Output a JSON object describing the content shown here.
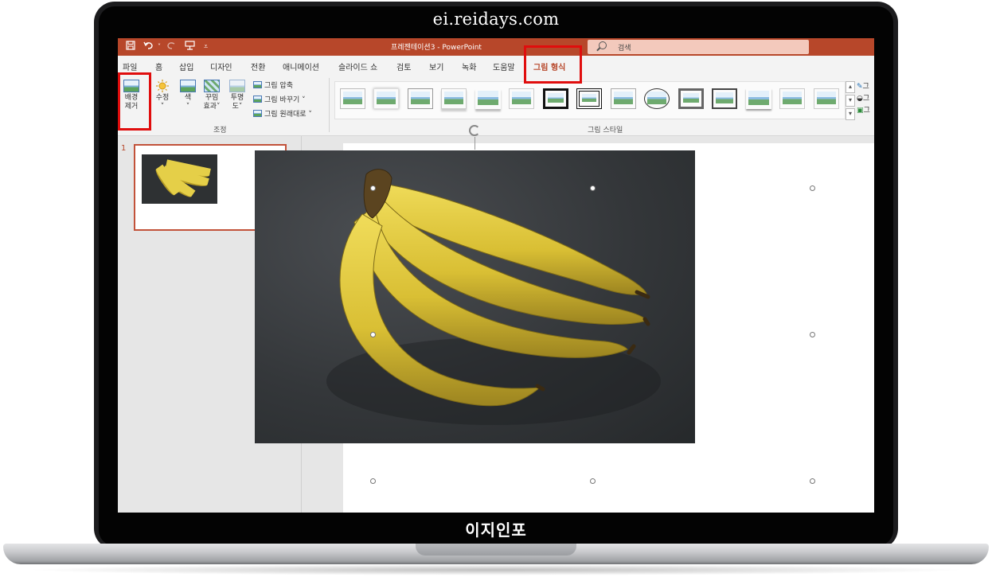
{
  "site_title": "ei.reidays.com",
  "watermark": "이지인포",
  "colors": {
    "accent": "#b7472a",
    "highlight_box": "#e00d0d",
    "search_bg": "#f3c9bc"
  },
  "titlebar": {
    "doc_title": "프레젠테이션3  -  PowerPoint",
    "search_placeholder": "검색",
    "quick_access": [
      "save-icon",
      "undo-icon",
      "redo-icon",
      "present-icon",
      "customize-icon"
    ]
  },
  "tabs": [
    {
      "label": "파일"
    },
    {
      "label": "홈"
    },
    {
      "label": "삽입"
    },
    {
      "label": "디자인"
    },
    {
      "label": "전환"
    },
    {
      "label": "애니메이션"
    },
    {
      "label": "슬라이드 쇼"
    },
    {
      "label": "검토"
    },
    {
      "label": "보기"
    },
    {
      "label": "녹화"
    },
    {
      "label": "도움말"
    },
    {
      "label": "그림 형식",
      "active": true
    }
  ],
  "ribbon": {
    "adjust": {
      "remove_background": {
        "line1": "배경",
        "line2": "제거"
      },
      "corrections": {
        "line1": "수정"
      },
      "color": {
        "line1": "색"
      },
      "artistic": {
        "line1": "꾸밈",
        "line2": "효과"
      },
      "transparency": {
        "line1": "투명",
        "line2": "도"
      },
      "compress": "그림 압축",
      "change": "그림 바꾸기",
      "reset": "그림 원래대로",
      "group_label": "조정"
    },
    "styles": {
      "group_label": "그림 스타일",
      "items": [
        "simple-frame",
        "soft-edge",
        "beveled",
        "reflected",
        "reflected-soft",
        "drop-shadow",
        "thick-black",
        "double-black",
        "rotated",
        "oval",
        "metal-frame",
        "center-shadow",
        "soft-rect",
        "reflected-bevel",
        "simple-white"
      ]
    },
    "right_items": [
      "그",
      "그",
      "그"
    ]
  },
  "slides": [
    {
      "number": "1"
    }
  ]
}
